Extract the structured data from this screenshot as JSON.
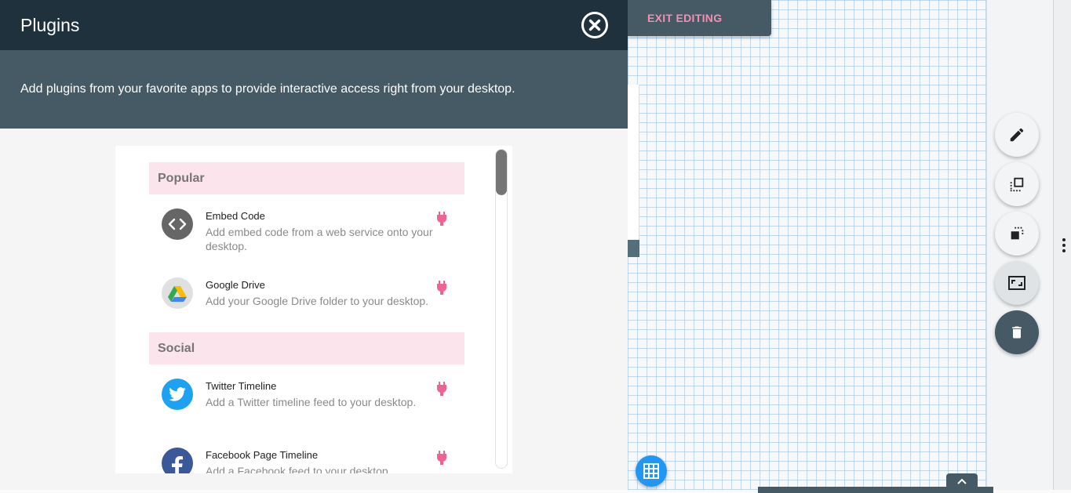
{
  "panel": {
    "title": "Plugins",
    "description": "Add plugins from your favorite apps to provide interactive access right from your desktop."
  },
  "toolbar": {
    "exit_label": "EXIT EDITING"
  },
  "sections": [
    {
      "label": "Popular",
      "items": [
        {
          "title": "Embed Code",
          "description": "Add embed code from a web service onto your desktop.",
          "icon": "code-icon"
        },
        {
          "title": "Google Drive",
          "description": "Add your Google Drive folder to your desktop.",
          "icon": "google-drive-icon"
        }
      ]
    },
    {
      "label": "Social",
      "items": [
        {
          "title": "Twitter Timeline",
          "description": "Add a Twitter timeline feed to your desktop.",
          "icon": "twitter-icon"
        },
        {
          "title": "Facebook Page Timeline",
          "description": "Add a Facebook feed to your desktop.",
          "icon": "facebook-icon"
        }
      ]
    }
  ],
  "colors": {
    "header_bg": "#1e313d",
    "subheader_bg": "#455a64",
    "section_bg": "#fce4ec",
    "accent_pink": "#f06292",
    "fab_blue": "#2196f3",
    "twitter_blue": "#1da1f2",
    "facebook_blue": "#3b5998"
  },
  "side_tools": [
    "pencil-icon",
    "bring-front-icon",
    "send-back-icon",
    "aspect-ratio-icon",
    "trash-icon"
  ]
}
